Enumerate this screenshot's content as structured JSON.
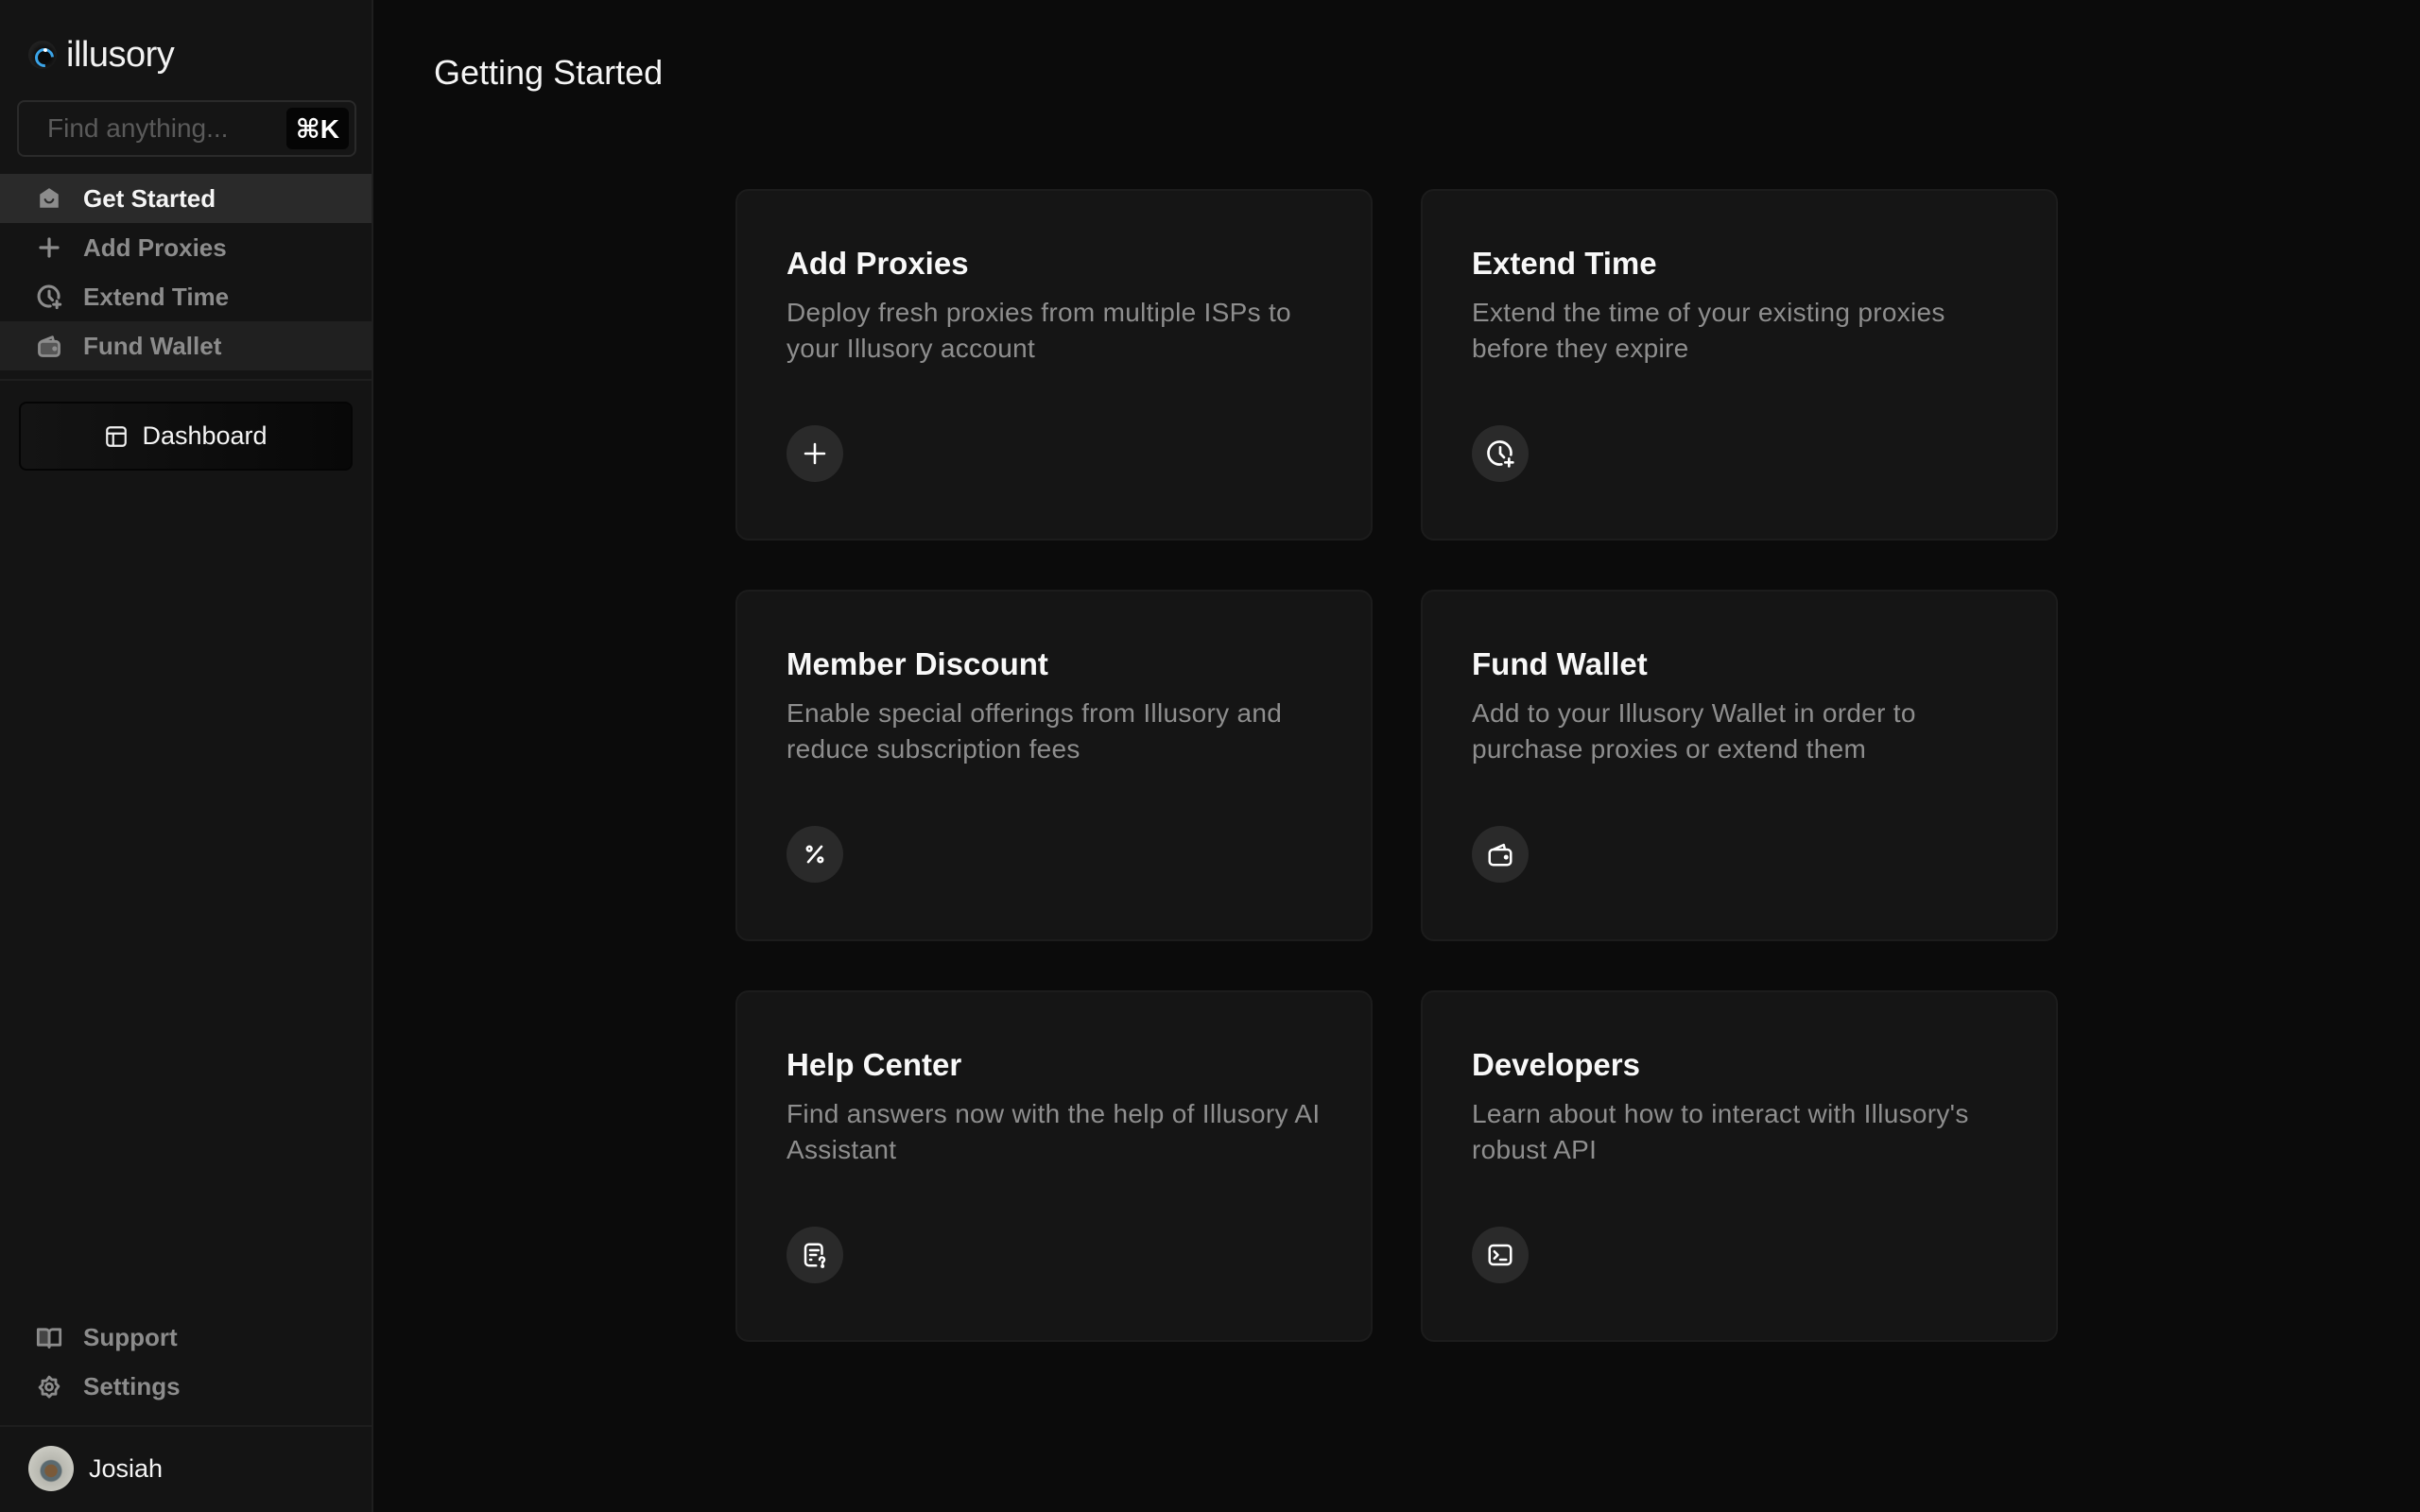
{
  "app": {
    "name": "illusory",
    "page_title": "Getting Started"
  },
  "sidebar": {
    "search": {
      "placeholder": "Find anything...",
      "value": "",
      "shortcut": "⌘K"
    },
    "nav_items": [
      {
        "label": "Get Started",
        "icon": "home-smile-icon",
        "active": true
      },
      {
        "label": "Add Proxies",
        "icon": "plus-icon",
        "active": false
      },
      {
        "label": "Extend Time",
        "icon": "clock-plus-icon",
        "active": false
      },
      {
        "label": "Fund Wallet",
        "icon": "wallet-icon",
        "active": false
      }
    ],
    "dashboard_button": {
      "label": "Dashboard",
      "icon": "layout-icon"
    },
    "bottom_items": [
      {
        "label": "Support",
        "icon": "book-icon"
      },
      {
        "label": "Settings",
        "icon": "gear-icon"
      }
    ],
    "user": {
      "name": "Josiah"
    }
  },
  "cards": [
    {
      "title": "Add Proxies",
      "description": "Deploy fresh proxies from multiple ISPs to your Illusory account",
      "icon": "plus-icon"
    },
    {
      "title": "Extend Time",
      "description": "Extend the time of your existing proxies before they expire",
      "icon": "clock-plus-icon"
    },
    {
      "title": "Member Discount",
      "description": "Enable special offerings from Illusory and reduce subscription fees",
      "icon": "percent-icon"
    },
    {
      "title": "Fund Wallet",
      "description": "Add to your Illusory Wallet in order to purchase proxies or extend them",
      "icon": "wallet-icon"
    },
    {
      "title": "Help Center",
      "description": "Find answers now with the help of Illusory AI Assistant",
      "icon": "file-question-icon"
    },
    {
      "title": "Developers",
      "description": "Learn about how to interact with Illusory's robust API",
      "icon": "terminal-icon"
    }
  ],
  "colors": {
    "background": "#0b0b0b",
    "sidebar": "#141414",
    "card": "#151515",
    "active_nav": "#2a2a2a",
    "accent_logo": "#3ba4e8",
    "muted_text": "#8e8e8e"
  }
}
